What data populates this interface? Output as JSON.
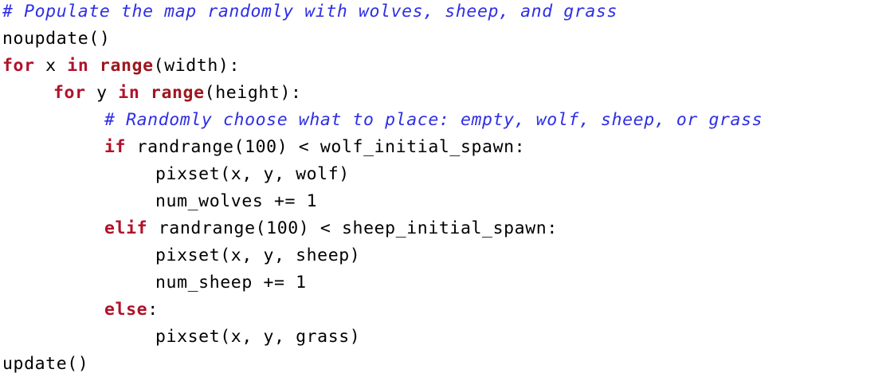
{
  "colors": {
    "comment": "#2e2ee6",
    "keyword": "#b0122a",
    "text": "#000000",
    "background": "#ffffff"
  },
  "lines": [
    {
      "c": "# Populate the map randomly with wolves, sheep, and grass"
    },
    {
      "t": "noupdate()"
    },
    {
      "k1": "for",
      "t1": " x ",
      "k2": "in",
      "t2": " ",
      "f": "range",
      "t3": "(width):"
    },
    {
      "k1": "for",
      "t1": " y ",
      "k2": "in",
      "t2": " ",
      "f": "range",
      "t3": "(height):"
    },
    {
      "c": "# Randomly choose what to place: empty, wolf, sheep, or grass"
    },
    {
      "k": "if",
      "t": " randrange(100) < wolf_initial_spawn:"
    },
    {
      "t": "pixset(x, y, wolf)"
    },
    {
      "t": "num_wolves += 1"
    },
    {
      "k": "elif",
      "t": " randrange(100) < sheep_initial_spawn:"
    },
    {
      "t": "pixset(x, y, sheep)"
    },
    {
      "t": "num_sheep += 1"
    },
    {
      "k": "else",
      "t": ":"
    },
    {
      "t": "pixset(x, y, grass)"
    },
    {
      "t": "update()"
    }
  ]
}
